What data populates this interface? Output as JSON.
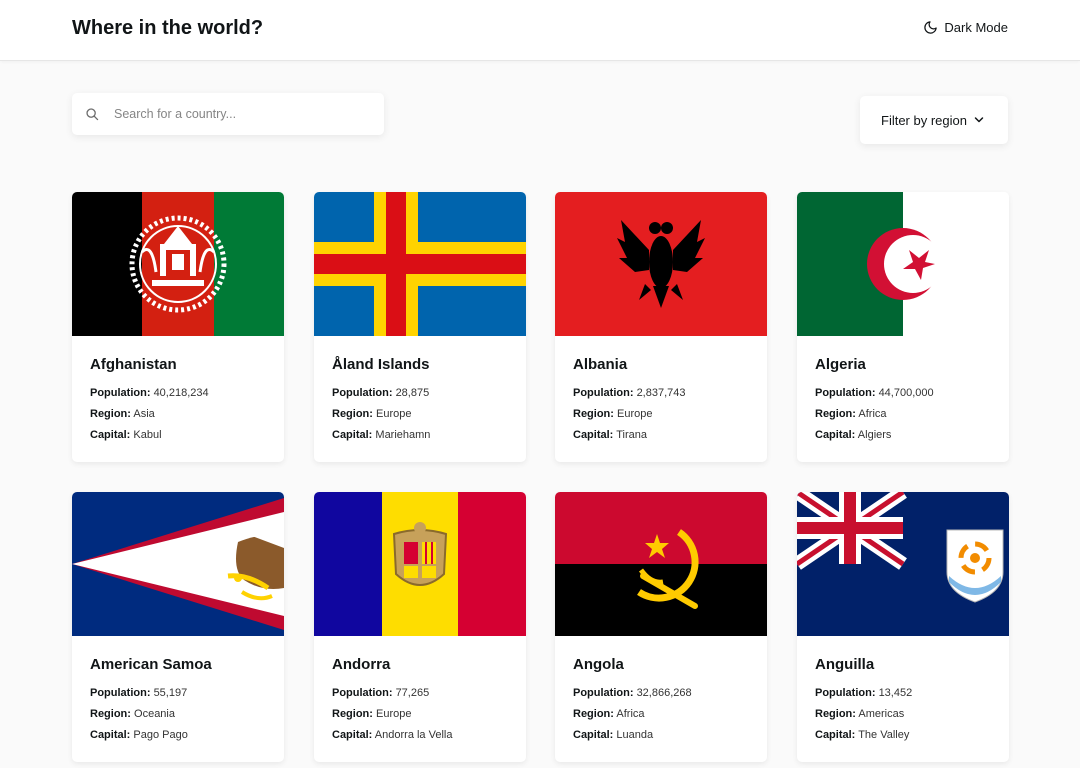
{
  "header": {
    "title": "Where in the world?",
    "theme_toggle_label": "Dark Mode",
    "theme_icon": "moon-icon"
  },
  "search": {
    "placeholder": "Search for a country...",
    "value": "",
    "icon": "search-icon"
  },
  "filter": {
    "label": "Filter by region",
    "icon": "chevron-down-icon"
  },
  "labels": {
    "population": "Population:",
    "region": "Region:",
    "capital": "Capital:"
  },
  "countries": [
    {
      "name": "Afghanistan",
      "population": "40,218,234",
      "region": "Asia",
      "capital": "Kabul"
    },
    {
      "name": "Åland Islands",
      "population": "28,875",
      "region": "Europe",
      "capital": "Mariehamn"
    },
    {
      "name": "Albania",
      "population": "2,837,743",
      "region": "Europe",
      "capital": "Tirana"
    },
    {
      "name": "Algeria",
      "population": "44,700,000",
      "region": "Africa",
      "capital": "Algiers"
    },
    {
      "name": "American Samoa",
      "population": "55,197",
      "region": "Oceania",
      "capital": "Pago Pago"
    },
    {
      "name": "Andorra",
      "population": "77,265",
      "region": "Europe",
      "capital": "Andorra la Vella"
    },
    {
      "name": "Angola",
      "population": "32,866,268",
      "region": "Africa",
      "capital": "Luanda"
    },
    {
      "name": "Anguilla",
      "population": "13,452",
      "region": "Americas",
      "capital": "The Valley"
    }
  ],
  "colors": {
    "background": "#fafafa",
    "card": "#ffffff",
    "text": "#111517"
  }
}
